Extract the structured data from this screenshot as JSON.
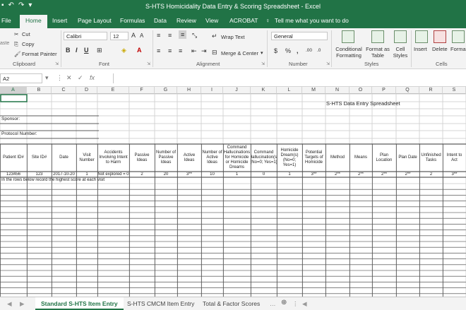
{
  "window": {
    "title": "S-HTS Homicidality Data Entry & Scoring Spreadsheet - Excel"
  },
  "ribbon_tabs": [
    "File",
    "Home",
    "Insert",
    "Page Layout",
    "Formulas",
    "Data",
    "Review",
    "View",
    "ACROBAT"
  ],
  "tell_me": "Tell me what you want to do",
  "clipboard": {
    "cut": "Cut",
    "copy": "Copy",
    "paste": "aste",
    "format_painter": "Format Painter",
    "group": "Clipboard"
  },
  "font": {
    "name": "Calibri",
    "size": "12",
    "group": "Font"
  },
  "alignment": {
    "wrap_text": "Wrap Text",
    "merge_center": "Merge & Center",
    "group": "Alignment"
  },
  "number": {
    "format": "General",
    "group": "Number"
  },
  "styles": {
    "conditional_formatting": "Conditional Formatting",
    "format_as_table": "Format as Table",
    "cell_styles": "Cell Styles",
    "group": "Styles"
  },
  "cells": {
    "insert": "Insert",
    "delete": "Delete",
    "format": "Forma",
    "group": "Cells"
  },
  "formula_bar": {
    "name_box": "A2",
    "fx": "fx",
    "content": ""
  },
  "columns": [
    "A",
    "B",
    "C",
    "D",
    "E",
    "F",
    "G",
    "H",
    "I",
    "J",
    "K",
    "L",
    "M",
    "N",
    "O",
    "P",
    "Q",
    "R",
    "S"
  ],
  "sheet": {
    "sheet_title": "S-HTS Data Entry Spreadsheet",
    "sponsor_label": "Sponsor:",
    "protocol_label": "Protocol Number:",
    "table_headers": [
      "Patient ID#",
      "Site ID#",
      "Date",
      "Visit Number",
      "Accidents Involving Intent to Harm",
      "Passive Ideas",
      "Number of Passive Ideas",
      "Active Ideas",
      "Number of Active Ideas",
      "Command Hallucinations for Homicide or Homicide Dreams",
      "Command Hallucination(s) (No=0; Yes=1)",
      "Homicide Dream(s) (No=0; Yes=1)",
      "Potential Targets of Homicide",
      "Method",
      "Means",
      "Plan Location",
      "Plan Date",
      "Unfinished Tasks",
      "Intent to Act"
    ],
    "example_row": [
      "123456",
      "123",
      "2017-10-20",
      "1",
      "Not explored = 0",
      "2",
      "20",
      "3**",
      "10",
      "1",
      "0",
      "1",
      "3**",
      "2**",
      "2**",
      "2**",
      "2**",
      "2",
      "3**"
    ],
    "note": "In the rows below record the highest score at each visit"
  },
  "sheet_tabs": [
    "Standard S-HTS Item Entry",
    "S-HTS CMCM Item Entry",
    "Total & Factor Scores"
  ],
  "active_sheet": "Standard S-HTS Item Entry",
  "colors": {
    "excel_green": "#217346",
    "gridline": "#d4d4d4"
  }
}
